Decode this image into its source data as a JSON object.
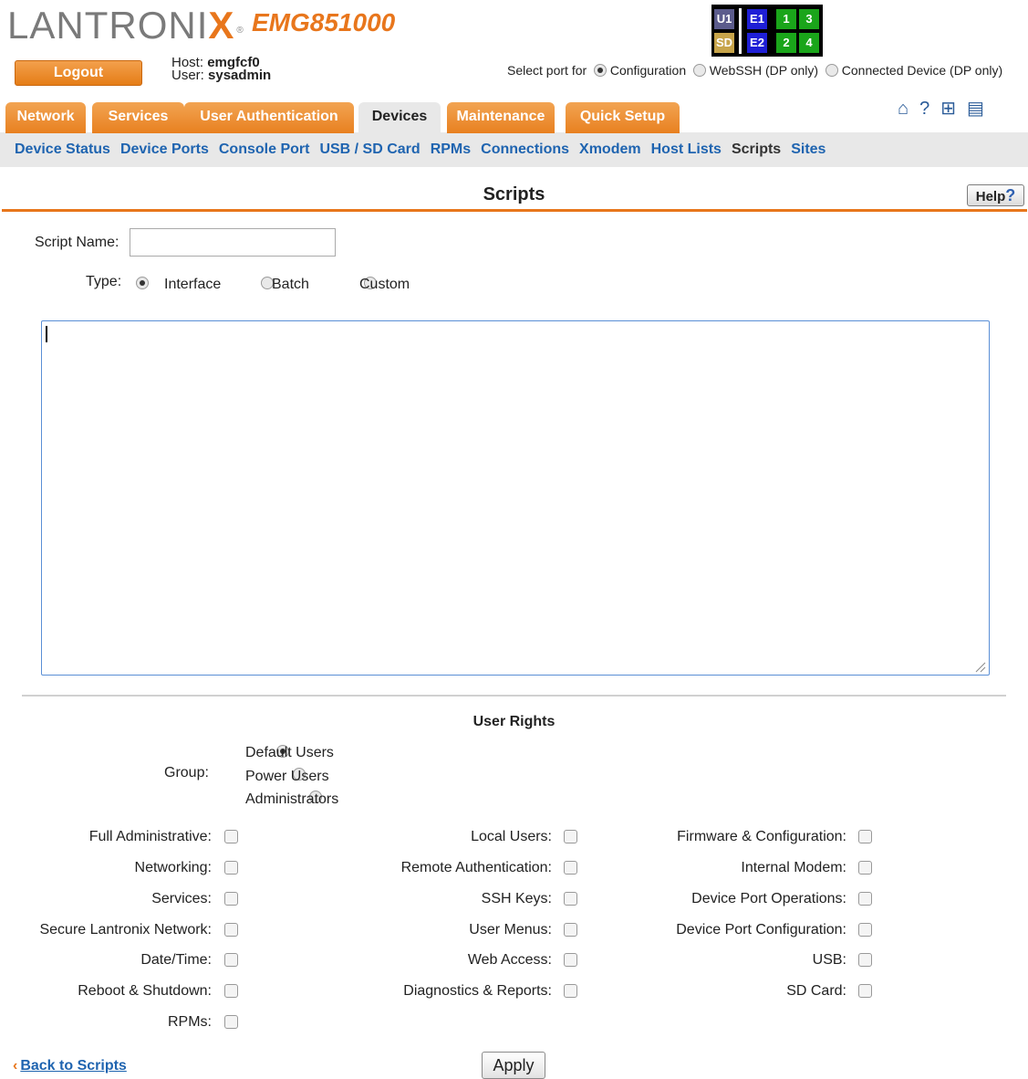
{
  "header": {
    "brand_prefix": "LANTRONI",
    "brand_x": "X",
    "brand_reg": "®",
    "model": "EMG851000",
    "logout_label": "Logout",
    "host_label": "Host:",
    "host_value": "emgfcf0",
    "user_label": "User:",
    "user_value": "sysadmin"
  },
  "status_grid": {
    "cells": [
      "U1",
      "SD",
      "E1",
      "E2",
      "1",
      "2",
      "3",
      "4"
    ],
    "colors": {
      "u1": "#5b5b8c",
      "sd": "#c7a44a",
      "e": "#1f1fd6",
      "num": "#1aa51a"
    }
  },
  "port_select": {
    "label": "Select port for",
    "options": [
      "Configuration",
      "WebSSH (DP only)",
      "Connected Device (DP only)"
    ],
    "selected": "Configuration"
  },
  "tabs": [
    "Network",
    "Services",
    "User Authentication",
    "Devices",
    "Maintenance",
    "Quick Setup"
  ],
  "active_tab": "Devices",
  "subnav": [
    "Device Status",
    "Device Ports",
    "Console Port",
    "USB / SD Card",
    "RPMs",
    "Connections",
    "Xmodem",
    "Host Lists",
    "Scripts",
    "Sites"
  ],
  "active_subnav": "Scripts",
  "tool_icons": [
    "home-icon",
    "question-icon",
    "sitemap-icon",
    "notes-icon"
  ],
  "page": {
    "title": "Scripts",
    "help_label": "Help",
    "help_mark": "?"
  },
  "form": {
    "script_name_label": "Script Name:",
    "script_name_value": "",
    "type_label": "Type:",
    "type_options": [
      "Interface",
      "Batch",
      "Custom"
    ],
    "type_selected": "Interface",
    "script_content": ""
  },
  "user_rights": {
    "title": "User Rights",
    "group_label": "Group:",
    "group_options": [
      "Default Users",
      "Power Users",
      "Administrators"
    ],
    "group_selected": "Default Users",
    "col1": [
      "Full Administrative:",
      "Networking:",
      "Services:",
      "Secure Lantronix Network:",
      "Date/Time:",
      "Reboot & Shutdown:",
      "RPMs:"
    ],
    "col2": [
      "Local Users:",
      "Remote Authentication:",
      "SSH Keys:",
      "User Menus:",
      "Web Access:",
      "Diagnostics & Reports:"
    ],
    "col3": [
      "Firmware & Configuration:",
      "Internal Modem:",
      "Device Port Operations:",
      "Device Port Configuration:",
      "USB:",
      "SD Card:"
    ]
  },
  "footer": {
    "back_chevron": "‹",
    "back_label": "Back to Scripts",
    "apply_label": "Apply"
  }
}
